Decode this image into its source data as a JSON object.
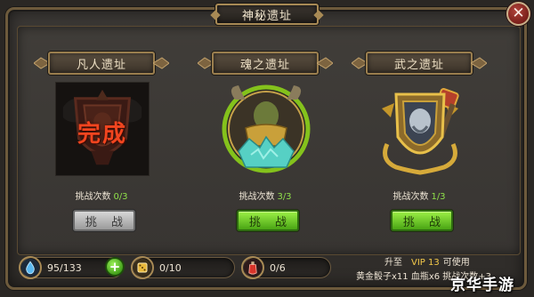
{
  "window": {
    "title": "神秘遗址",
    "close_glyph": "✕"
  },
  "ruins": [
    {
      "name": "凡人遗址",
      "status_stamp": "完成",
      "attempts_label": "挑战次数",
      "attempts_count": "0/3",
      "button_label": "挑 战",
      "button_state": "disabled"
    },
    {
      "name": "魂之遗址",
      "attempts_label": "挑战次数",
      "attempts_count": "3/3",
      "button_label": "挑 战",
      "button_state": "enabled"
    },
    {
      "name": "武之遗址",
      "attempts_label": "挑战次数",
      "attempts_count": "1/3",
      "button_label": "挑 战",
      "button_state": "enabled"
    }
  ],
  "resources": {
    "stamina": {
      "icon": "stamina-drop-icon",
      "value": "95/133",
      "plus_glyph": "+"
    },
    "dice": {
      "icon": "golden-dice-icon",
      "value": "0/10"
    },
    "bottle": {
      "icon": "blood-bottle-icon",
      "value": "0/6"
    }
  },
  "vip_info": {
    "prefix": "升至",
    "vip_level": "VIP 13",
    "suffix": "可使用",
    "line2": "黄金骰子x11 血瓶x6 挑战次数+3"
  },
  "watermark": "京华手游",
  "colors": {
    "frame_gold": "#a88a55",
    "count_green": "#8fe04a",
    "button_green": "#6cc82a",
    "close_red": "#9a2c25"
  }
}
